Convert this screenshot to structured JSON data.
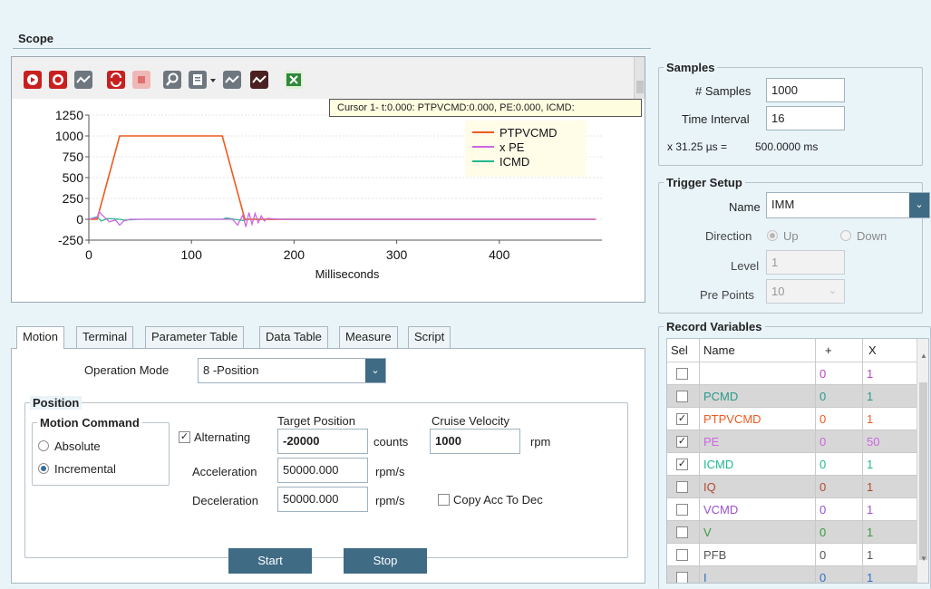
{
  "scope": {
    "title": "Scope",
    "cursor_tooltip": "Cursor 1- t:0.000: PTPVCMD:0.000, PE:0.000, ICMD:",
    "toolbar": [
      "record-start-icon",
      "record-stop-icon",
      "waveform-icon",
      "refresh-icon",
      "stop-icon",
      "zoom-icon",
      "document-icon",
      "dropdown-icon",
      "waveform-icon",
      "waveform-dark-icon",
      "excel-export-icon"
    ]
  },
  "chart_data": {
    "type": "line",
    "xlabel": "Milliseconds",
    "ylabel": "",
    "xlim": [
      0,
      500
    ],
    "ylim": [
      -250,
      1250
    ],
    "x_ticks": [
      "0",
      "100",
      "200",
      "300",
      "400"
    ],
    "y_ticks": [
      "1250",
      "1000",
      "750",
      "500",
      "250",
      "0",
      "-250"
    ],
    "legend_position": "top-right",
    "series": [
      {
        "name": "PTPVCMD",
        "color": "#f05a1e",
        "x": [
          0,
          8,
          30,
          130,
          152,
          494
        ],
        "y": [
          0,
          0,
          1000,
          1000,
          0,
          0
        ]
      },
      {
        "name": "x PE",
        "color": "#cc66e0",
        "x": [
          0,
          8,
          10,
          14,
          20,
          26,
          30,
          34,
          40,
          140,
          145,
          150,
          153,
          156,
          159,
          162,
          165,
          168,
          171,
          174,
          180,
          190,
          200,
          494
        ],
        "y": [
          0,
          20,
          90,
          40,
          -30,
          -10,
          -70,
          -20,
          0,
          0,
          -70,
          50,
          -90,
          80,
          -60,
          70,
          -40,
          40,
          -20,
          10,
          5,
          0,
          0,
          0
        ]
      },
      {
        "name": "ICMD",
        "color": "#20b890",
        "x": [
          0,
          8,
          12,
          18,
          30,
          34,
          50,
          130,
          134,
          150,
          156,
          494
        ],
        "y": [
          0,
          30,
          -20,
          10,
          0,
          -10,
          0,
          0,
          15,
          -15,
          0,
          0
        ]
      }
    ]
  },
  "tabs": [
    "Motion",
    "Terminal",
    "Parameter Table",
    "Data Table",
    "Measure",
    "Script"
  ],
  "motion": {
    "operation_mode_label": "Operation Mode",
    "operation_mode_value": "8 -Position",
    "position_title": "Position",
    "motion_command_title": "Motion Command",
    "absolute_label": "Absolute",
    "incremental_label": "Incremental",
    "alternating_label": "Alternating",
    "target_position_label": "Target Position",
    "target_position_value": "-20000",
    "target_position_unit": "counts",
    "cruise_velocity_label": "Cruise Velocity",
    "cruise_velocity_value": "1000",
    "cruise_velocity_unit": "rpm",
    "acceleration_label": "Acceleration",
    "acceleration_value": "50000.000",
    "acceleration_unit": "rpm/s",
    "deceleration_label": "Deceleration",
    "deceleration_value": "50000.000",
    "deceleration_unit": "rpm/s",
    "copy_acc_label": "Copy Acc To Dec",
    "start_label": "Start",
    "stop_label": "Stop"
  },
  "samples": {
    "title": "Samples",
    "num_samples_label": "# Samples",
    "num_samples_value": "1000",
    "time_interval_label": "Time Interval",
    "time_interval_value": "16",
    "period_label": "x 31.25 µs =",
    "period_value": "500.0000 ms"
  },
  "trigger": {
    "title": "Trigger Setup",
    "name_label": "Name",
    "name_value": "IMM",
    "direction_label": "Direction",
    "up_label": "Up",
    "down_label": "Down",
    "level_label": "Level",
    "level_value": "1",
    "pre_points_label": "Pre Points",
    "pre_points_value": "10"
  },
  "record_variables": {
    "title": "Record Variables",
    "headers": [
      "Sel",
      "Name",
      "+",
      "X"
    ],
    "rows": [
      {
        "checked": false,
        "name": "",
        "plus": "0",
        "x": "1",
        "color": "#333333",
        "plus_color": "#c040c0",
        "shaded": false
      },
      {
        "checked": false,
        "name": "PCMD",
        "plus": "0",
        "x": "1",
        "color": "#2a9a8a",
        "plus_color": "#2a9a8a",
        "shaded": true
      },
      {
        "checked": true,
        "name": "PTPVCMD",
        "plus": "0",
        "x": "1",
        "color": "#f05a1e",
        "plus_color": "#f05a1e",
        "shaded": false
      },
      {
        "checked": true,
        "name": "PE",
        "plus": "0",
        "x": "50",
        "color": "#cc66e0",
        "plus_color": "#cc66e0",
        "shaded": true
      },
      {
        "checked": true,
        "name": "ICMD",
        "plus": "0",
        "x": "1",
        "color": "#20b890",
        "plus_color": "#20b890",
        "shaded": false
      },
      {
        "checked": false,
        "name": "IQ",
        "plus": "0",
        "x": "1",
        "color": "#b04a30",
        "plus_color": "#b04a30",
        "shaded": true
      },
      {
        "checked": false,
        "name": "VCMD",
        "plus": "0",
        "x": "1",
        "color": "#9a50d0",
        "plus_color": "#9a50d0",
        "shaded": false
      },
      {
        "checked": false,
        "name": "V",
        "plus": "0",
        "x": "1",
        "color": "#3a9a40",
        "plus_color": "#3a9a40",
        "shaded": true
      },
      {
        "checked": false,
        "name": "PFB",
        "plus": "0",
        "x": "1",
        "color": "#555555",
        "plus_color": "#555555",
        "shaded": false
      },
      {
        "checked": false,
        "name": "I",
        "plus": "0",
        "x": "1",
        "color": "#3070c0",
        "plus_color": "#3070c0",
        "shaded": true
      }
    ]
  }
}
